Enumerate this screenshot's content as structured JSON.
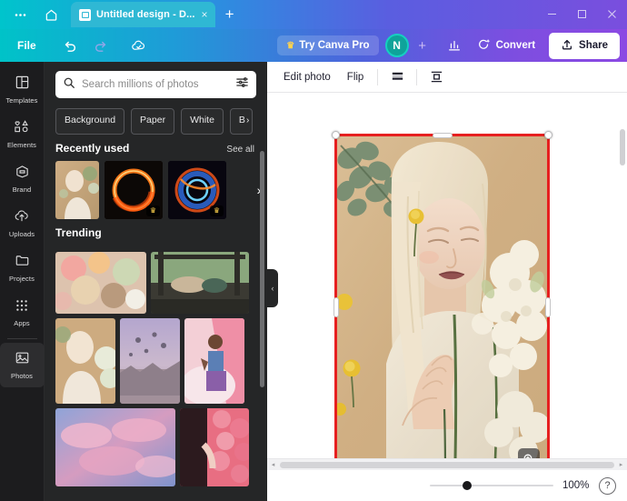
{
  "window": {
    "tab_title": "Untitled design - D...",
    "tab_close": "×",
    "new_tab": "+",
    "minimize": "─",
    "maximize": "□",
    "close": "✕"
  },
  "topbar": {
    "file_label": "File",
    "undo_icon": "undo-icon",
    "redo_icon": "redo-icon",
    "cloud_icon": "cloud-sync-icon",
    "try_pro_label": "Try Canva Pro",
    "crown_icon": "♛",
    "avatar_initial": "N",
    "add_people": "+",
    "insights_icon": "bar-chart-icon",
    "convert_label": "Convert",
    "share_label": "Share"
  },
  "rail": {
    "items": [
      {
        "label": "Templates",
        "icon": "templates-icon",
        "active": false
      },
      {
        "label": "Elements",
        "icon": "elements-icon",
        "active": false
      },
      {
        "label": "Brand",
        "icon": "brand-icon",
        "active": false
      },
      {
        "label": "Uploads",
        "icon": "uploads-icon",
        "active": false
      },
      {
        "label": "Projects",
        "icon": "projects-icon",
        "active": false
      },
      {
        "label": "Apps",
        "icon": "apps-icon",
        "active": false
      },
      {
        "label": "Photos",
        "icon": "photos-icon",
        "active": true
      }
    ]
  },
  "panel": {
    "search": {
      "placeholder": "Search millions of photos",
      "value": "",
      "search_icon": "search-icon",
      "filter_icon": "filter-sliders-icon"
    },
    "chips": [
      "Background",
      "Paper",
      "White",
      "B"
    ],
    "recently_used": {
      "title": "Recently used",
      "see_all": "See all",
      "next_arrow": "›",
      "items": [
        {
          "name": "portrait-woman-flowers",
          "pro": false
        },
        {
          "name": "orange-light-ring",
          "pro": true
        },
        {
          "name": "blue-orange-energy-swirl",
          "pro": true
        }
      ]
    },
    "trending": {
      "title": "Trending",
      "items": [
        {
          "name": "pastel-flowers-closeup"
        },
        {
          "name": "patio-swing-bench"
        },
        {
          "name": "albino-woman-white-flowers"
        },
        {
          "name": "hot-air-balloons-valley"
        },
        {
          "name": "man-pink-fabric-clouds"
        },
        {
          "name": "pink-blue-clouds-sky"
        },
        {
          "name": "pink-balls-pool"
        }
      ]
    },
    "collapse_icon": "‹"
  },
  "editor": {
    "toolbar": {
      "edit_photo_label": "Edit photo",
      "flip_label": "Flip",
      "transparency_icon": "transparency-icon",
      "position_icon": "position-icon"
    },
    "canvas": {
      "selected_image": "albino-woman-white-flowers-yellow-billy-buttons",
      "selection_color": "#e62020",
      "magnify_icon": "magnify-plus-icon"
    },
    "status": {
      "zoom_level": "100%",
      "help_icon": "?",
      "scroll_left": "◂",
      "scroll_right": "▸"
    }
  }
}
